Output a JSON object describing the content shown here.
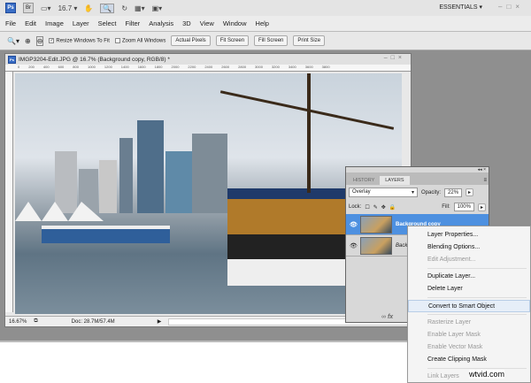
{
  "appbar": {
    "ps": "Ps",
    "br": "Br",
    "zoom_value": "16.7",
    "workspace": "ESSENTIALS"
  },
  "menu": [
    "File",
    "Edit",
    "Image",
    "Layer",
    "Select",
    "Filter",
    "Analysis",
    "3D",
    "View",
    "Window",
    "Help"
  ],
  "options": {
    "resize_windows": "Resize Windows To Fit",
    "zoom_all": "Zoom All Windows",
    "actual_pixels": "Actual Pixels",
    "fit_screen": "Fit Screen",
    "fill_screen": "Fill Screen",
    "print_size": "Print Size"
  },
  "document": {
    "title": "IMGP3204-Edit.JPG @ 16.7% (Background copy, RGB/8) *",
    "zoom": "16.67%",
    "doc_size": "Doc: 28.7M/57.4M",
    "ruler": [
      "0",
      "200",
      "400",
      "600",
      "800",
      "1000",
      "1200",
      "1400",
      "1600",
      "1800",
      "2000",
      "2200",
      "2400",
      "2600",
      "2800",
      "3000",
      "3200",
      "3400",
      "3600",
      "3800"
    ]
  },
  "layers_panel": {
    "tabs": [
      "HISTORY",
      "LAYERS"
    ],
    "blend_mode": "Overlay",
    "opacity_label": "Opacity:",
    "opacity": "22%",
    "lock_label": "Lock:",
    "fill_label": "Fill:",
    "fill": "100%",
    "layers": [
      "Background copy",
      "Background"
    ]
  },
  "context_menu": [
    {
      "label": "Layer Properties...",
      "enabled": true
    },
    {
      "label": "Blending Options...",
      "enabled": true
    },
    {
      "label": "Edit Adjustment...",
      "enabled": false
    },
    {
      "label": "Duplicate Layer...",
      "enabled": true
    },
    {
      "label": "Delete Layer",
      "enabled": true
    },
    {
      "label": "Convert to Smart Object",
      "enabled": true,
      "highlighted": true
    },
    {
      "label": "Rasterize Layer",
      "enabled": false
    },
    {
      "label": "Enable Layer Mask",
      "enabled": false
    },
    {
      "label": "Enable Vector Mask",
      "enabled": false
    },
    {
      "label": "Create Clipping Mask",
      "enabled": true
    },
    {
      "label": "Link Layers",
      "enabled": false
    }
  ],
  "watermark": "wtvid.com"
}
